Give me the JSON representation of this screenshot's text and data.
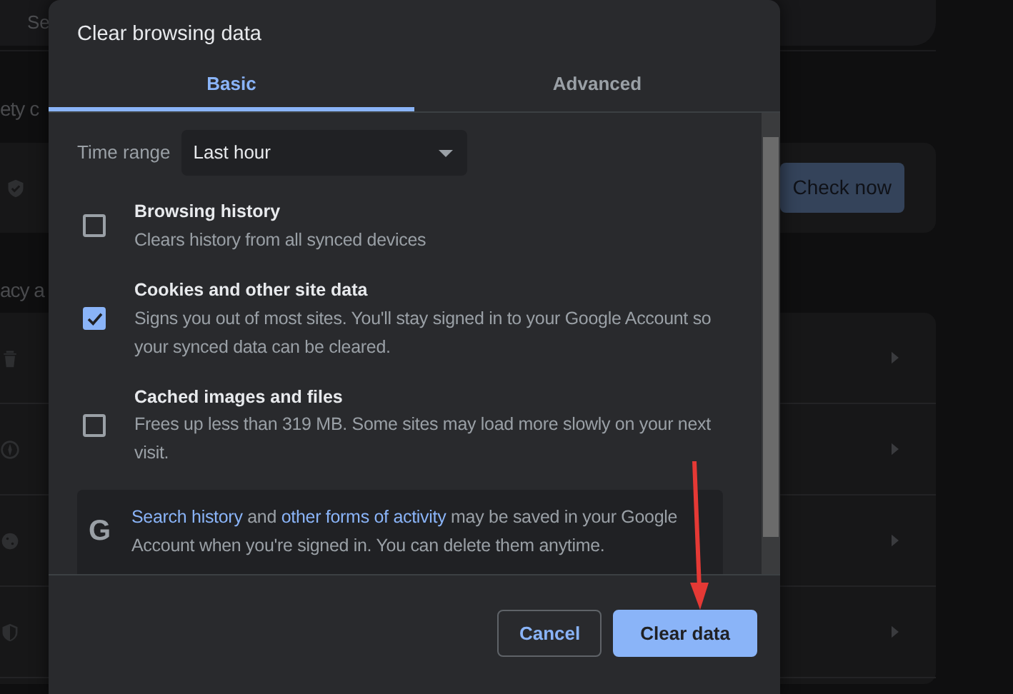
{
  "background": {
    "search_field": "Se",
    "safety_heading": "ety c",
    "safety_button": "Check now",
    "privacy_heading": "acy a"
  },
  "dialog": {
    "title": "Clear browsing data",
    "tabs": [
      {
        "label": "Basic",
        "selected": true
      },
      {
        "label": "Advanced",
        "selected": false
      }
    ],
    "time_range": {
      "label": "Time range",
      "value": "Last hour"
    },
    "options": [
      {
        "title": "Browsing history",
        "description": "Clears history from all synced devices",
        "checked": false
      },
      {
        "title": "Cookies and other site data",
        "description": "Signs you out of most sites. You'll stay signed in to your Google Account so your synced data can be cleared.",
        "checked": true
      },
      {
        "title": "Cached images and files",
        "description": "Frees up less than 319 MB. Some sites may load more slowly on your next visit.",
        "checked": false
      }
    ],
    "info": {
      "icon": "G",
      "parts": [
        {
          "kind": "link",
          "text": "Search history"
        },
        {
          "kind": "text",
          "text": "and"
        },
        {
          "kind": "link",
          "text": "other forms of activity"
        },
        {
          "kind": "text",
          "text": "may be saved in your Google Account when you're signed in. You can delete them anytime."
        }
      ]
    },
    "buttons": [
      {
        "kind": "secondary",
        "label": "Cancel"
      },
      {
        "kind": "primary",
        "label": "Clear data"
      }
    ]
  },
  "annotations": [
    {
      "kind": "arrow",
      "color": "#e53935"
    }
  ]
}
